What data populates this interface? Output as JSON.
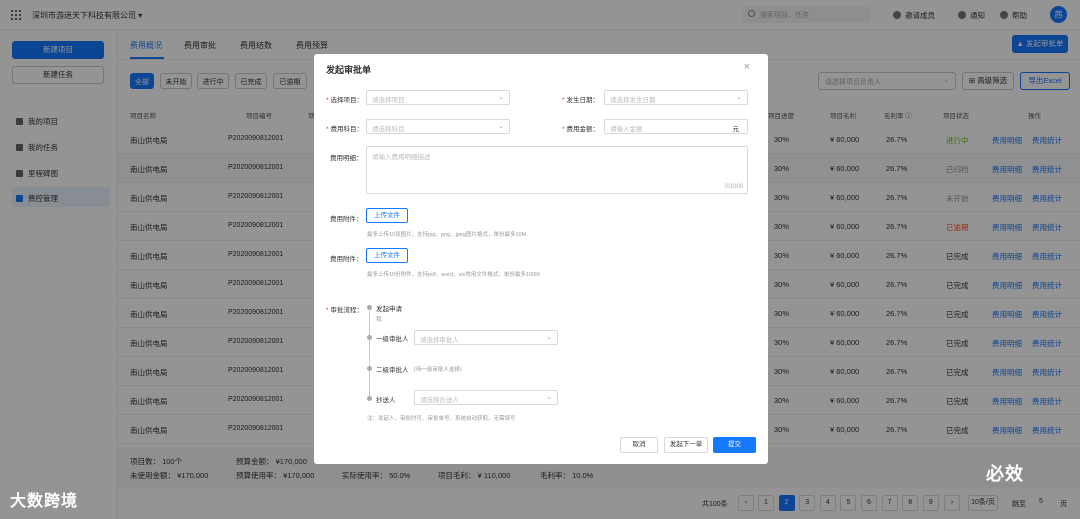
{
  "topbar": {
    "company": "深圳市游迷天下科技有限公司 ▾",
    "search_placeholder": "搜索项目、任务",
    "invite": "邀请成员",
    "notify": "通知",
    "help": "帮助",
    "avatar": "茜"
  },
  "sidebar": {
    "new_project": "新建项目",
    "new_task": "新建任务",
    "items": [
      {
        "label": "我的项目",
        "icon": "folder-icon"
      },
      {
        "label": "我的任务",
        "icon": "task-icon"
      },
      {
        "label": "里程碑图",
        "icon": "milestone-icon"
      },
      {
        "label": "费控管理",
        "icon": "expense-icon",
        "active": true
      }
    ]
  },
  "tabs": [
    "费用概况",
    "费用审批",
    "费用结数",
    "费用预算"
  ],
  "launch_button": "发起审批单",
  "filters": [
    "全部",
    "未开始",
    "进行中",
    "已完成",
    "已逾期"
  ],
  "right_select_placeholder": "请选择项目负责人",
  "advanced_filter": "高级筛选",
  "export": "导出Excel",
  "table": {
    "headers_left": [
      "项目名称",
      "项目编号",
      "项"
    ],
    "headers_right": [
      "项目进度",
      "项目毛利",
      "毛利率 ⓘ",
      "项目状态",
      "操作"
    ],
    "rows": [
      {
        "name": "南山供电局",
        "code": "P2020090812001",
        "progress": "30%",
        "profit": "¥ 60,000",
        "rate": "26.7%",
        "status": "进行中",
        "status_color": "#52c41a"
      },
      {
        "name": "南山供电局",
        "code": "P2020090812001",
        "progress": "30%",
        "profit": "¥ 60,000",
        "rate": "26.7%",
        "status": "已归档",
        "status_color": "#999999"
      },
      {
        "name": "南山供电局",
        "code": "P2020090812001",
        "progress": "30%",
        "profit": "¥ 60,000",
        "rate": "26.7%",
        "status": "未开始",
        "status_color": "#999999"
      },
      {
        "name": "南山供电局",
        "code": "P2020090812001",
        "progress": "30%",
        "profit": "¥ 60,000",
        "rate": "26.7%",
        "status": "已逾期",
        "status_color": "#fa541c"
      },
      {
        "name": "南山供电局",
        "code": "P2020090812001",
        "progress": "30%",
        "profit": "¥ 60,000",
        "rate": "26.7%",
        "status": "已完成",
        "status_color": "#333333"
      },
      {
        "name": "南山供电局",
        "code": "P2020090812001",
        "progress": "30%",
        "profit": "¥ 60,000",
        "rate": "26.7%",
        "status": "已完成",
        "status_color": "#333333"
      },
      {
        "name": "南山供电局",
        "code": "P2020090812001",
        "progress": "30%",
        "profit": "¥ 60,000",
        "rate": "26.7%",
        "status": "已完成",
        "status_color": "#333333"
      },
      {
        "name": "南山供电局",
        "code": "P2020090812001",
        "progress": "30%",
        "profit": "¥ 60,000",
        "rate": "26.7%",
        "status": "已完成",
        "status_color": "#333333"
      },
      {
        "name": "南山供电局",
        "code": "P2020090812001",
        "progress": "30%",
        "profit": "¥ 60,000",
        "rate": "26.7%",
        "status": "已完成",
        "status_color": "#333333"
      },
      {
        "name": "南山供电局",
        "code": "P2020090812001",
        "progress": "30%",
        "profit": "¥ 60,000",
        "rate": "26.7%",
        "status": "已完成",
        "status_color": "#333333"
      },
      {
        "name": "南山供电局",
        "code": "P2020090812001",
        "progress": "30%",
        "profit": "¥ 60,000",
        "rate": "26.7%",
        "status": "已完成",
        "status_color": "#333333"
      }
    ],
    "action_detail": "费用明细",
    "action_stats": "费用统计"
  },
  "summary": {
    "project_count": "项目数：  100个",
    "budget_amount": "预算金额：  ¥170,000",
    "unused_amount": "未使用金额：  ¥170,000",
    "budget_used": "预算使用率：  ¥170,000",
    "actual_rate": "实际使用率：  50.0%",
    "project_profit": "项目毛利：  ¥ 110,000",
    "profit_rate": "毛利率：  10.0%"
  },
  "pager": {
    "total": "共100条",
    "pages": [
      "1",
      "2",
      "3",
      "4",
      "5",
      "6",
      "7",
      "8",
      "9"
    ],
    "current": "2",
    "per_page": "10条/页",
    "jump_label": "跳至",
    "jump_value": "5",
    "page_unit": "页"
  },
  "modal": {
    "title": "发起审批单",
    "select_project_label": "选择项目：",
    "select_project_ph": "请选择项目",
    "date_label": "发生日期：",
    "date_ph": "请选择发生日期",
    "subject_label": "费用科目：",
    "subject_ph": "请选择科目",
    "amount_label": "费用金额：",
    "amount_ph": "请输入金额",
    "amount_unit": "元",
    "detail_label": "费用明细：",
    "detail_ph": "请输入费用明细描述",
    "detail_count": "0/1000",
    "attach1_label": "费用附件：",
    "upload": "上传文件",
    "attach1_hint": "最多上传10张图片，支持jpg、png、jpeg图片格式，单份最多10M",
    "attach2_label": "费用附件：",
    "attach2_hint": "最多上传10份附件，支持pdf、word、xls常用文件格式，单份最多100M",
    "flow_label": "审批流程：",
    "flow_start": "发起申请",
    "flow_start_sub": "我",
    "flow_first": "一级审批人",
    "flow_first_ph": "请选择审批人",
    "flow_second": "二级审批人",
    "flow_second_sub": "(待一级审批人选择)",
    "flow_cc": "抄送人",
    "flow_cc_ph": "请选择抄送人",
    "flow_note": "注：发起人、审批时可、审批单号、系统自动获取，无需填写",
    "cancel": "取消",
    "next": "发起下一单",
    "submit": "提交"
  },
  "watermarks": {
    "left": "大数跨境",
    "right": "必效"
  },
  "colors": {
    "primary": "#1677ff",
    "danger": "#f5222d"
  }
}
